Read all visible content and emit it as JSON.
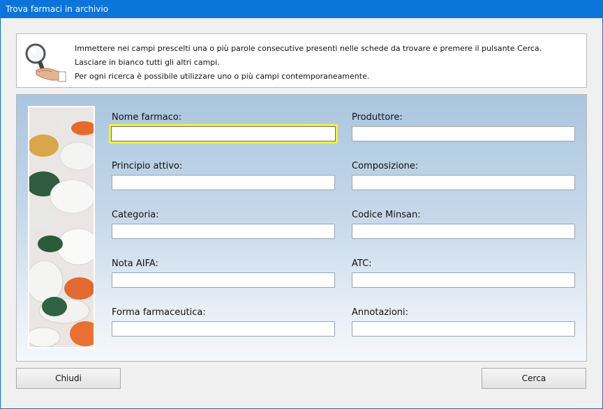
{
  "window": {
    "title": "Trova farmaci in archivio"
  },
  "info": {
    "icon": "magnifier-hand-icon",
    "lines": [
      "Immettere nei campi prescelti una o più parole consecutive presenti nelle schede da trovare e premere il pulsante Cerca.",
      "Lasciare in bianco tutti gli altri campi.",
      "Per ogni ricerca è possibile utilizzare uno o più campi contemporaneamente."
    ]
  },
  "form": {
    "image": "pills-image",
    "fields": {
      "nome_farmaco": {
        "label": "Nome farmaco:",
        "value": ""
      },
      "produttore": {
        "label": "Produttore:",
        "value": ""
      },
      "principio_attivo": {
        "label": "Principio attivo:",
        "value": ""
      },
      "composizione": {
        "label": "Composizione:",
        "value": ""
      },
      "categoria": {
        "label": "Categoria:",
        "value": ""
      },
      "codice_minsan": {
        "label": "Codice Minsan:",
        "value": ""
      },
      "nota_aifa": {
        "label": "Nota AIFA:",
        "value": ""
      },
      "atc": {
        "label": "ATC:",
        "value": ""
      },
      "forma_farmaceutica": {
        "label": "Forma farmaceutica:",
        "value": ""
      },
      "annotazioni": {
        "label": "Annotazioni:",
        "value": ""
      }
    }
  },
  "buttons": {
    "close_label": "Chiudi",
    "search_label": "Cerca"
  },
  "colors": {
    "titlebar": "#0b74da",
    "focus_border": "#f4f32d",
    "form_gradient_top": "#a9c6df"
  }
}
